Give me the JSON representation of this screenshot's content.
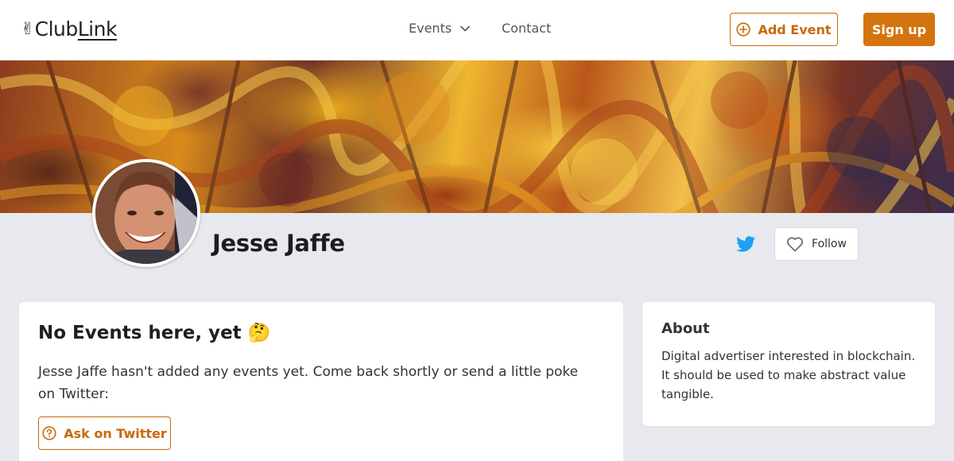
{
  "header": {
    "logo_emoji": "✌",
    "logo_club": "Club",
    "logo_link": "Link",
    "nav": {
      "events_label": "Events",
      "contact_label": "Contact"
    },
    "add_event_label": "Add Event",
    "sign_up_label": "Sign up"
  },
  "profile": {
    "name": "Jesse Jaffe",
    "follow_label": "Follow"
  },
  "events_card": {
    "title": "No Events here, yet 🤔",
    "message": "Jesse Jaffe hasn't added any events yet. Come back shortly or send a little poke on Twitter:",
    "ask_button_label": "Ask on Twitter"
  },
  "about_card": {
    "title": "About",
    "text": "Digital advertiser interested in blockchain. It should be used to make abstract value tangible."
  },
  "colors": {
    "accent": "#d4740e",
    "accent_outline": "#c8690b",
    "twitter": "#1da1f2",
    "page_background": "#e8e9ee"
  },
  "icons": {
    "events_dropdown": "chevron-down-icon",
    "add_event": "plus-circle-icon",
    "twitter": "twitter-icon",
    "follow": "heart-outline-icon",
    "ask": "question-circle-icon"
  }
}
